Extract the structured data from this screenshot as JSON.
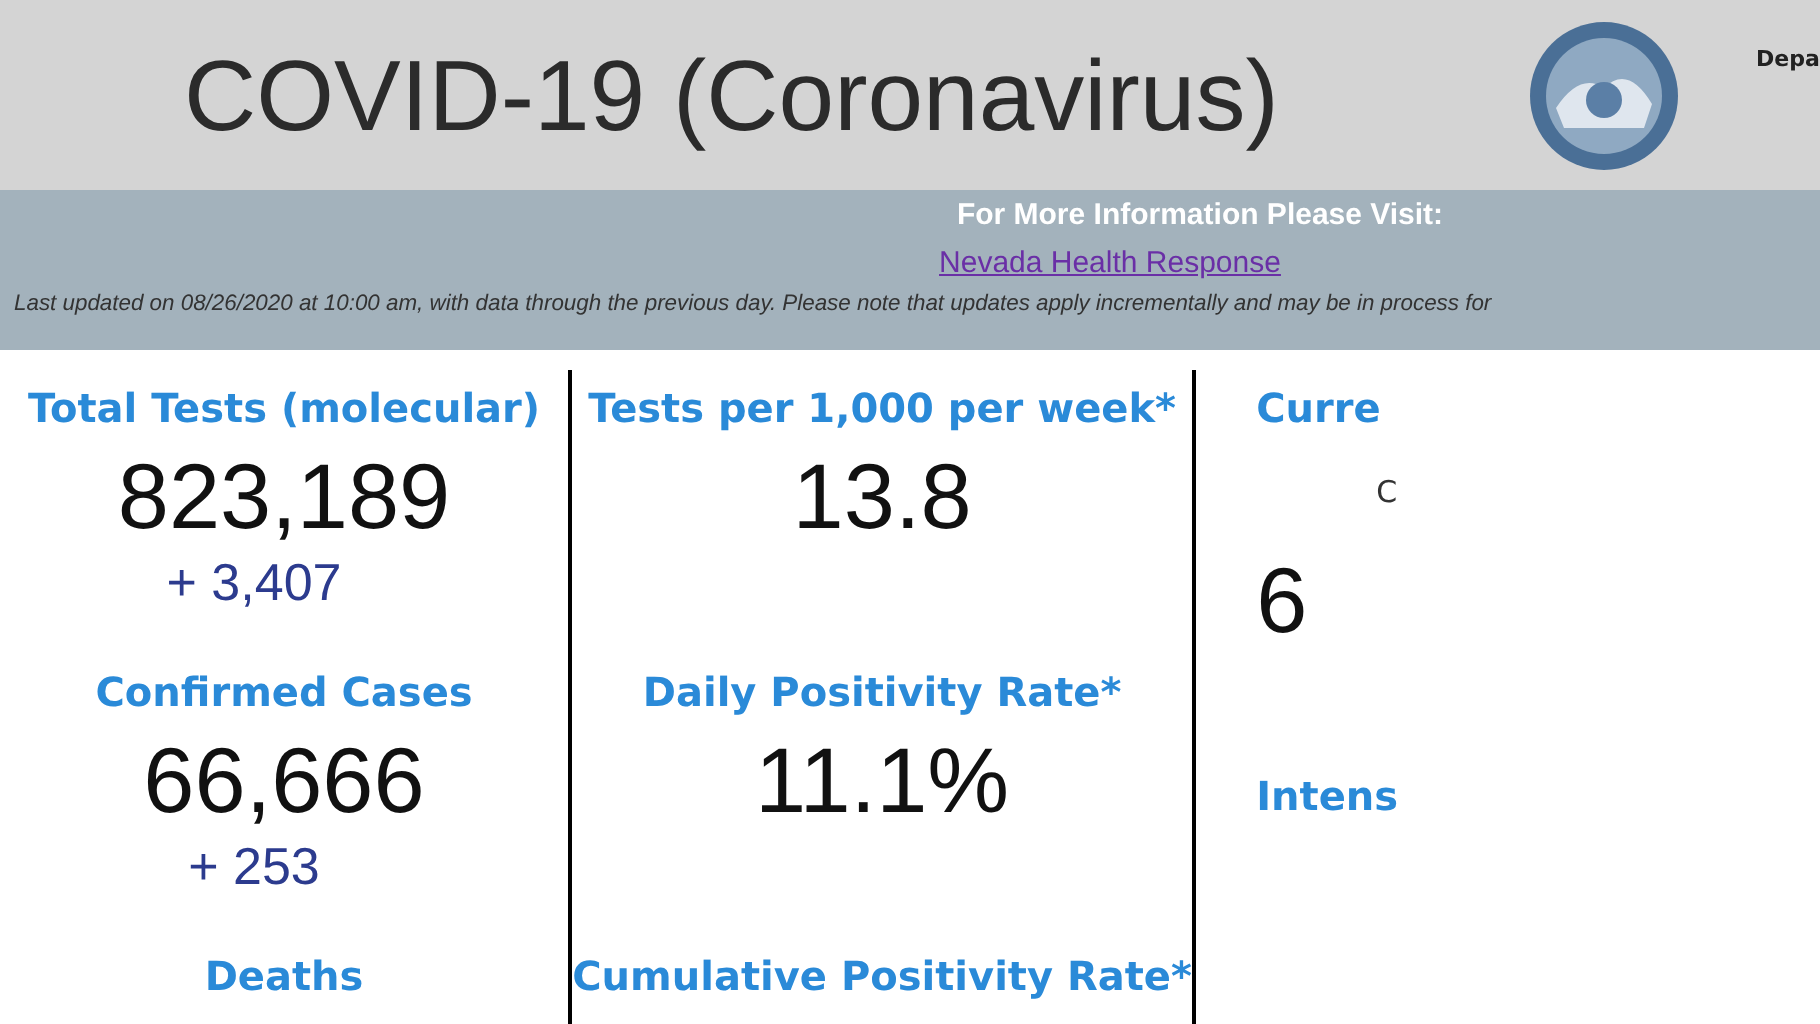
{
  "header": {
    "title": "COVID-19 (Coronavirus)",
    "department": "Depa"
  },
  "banner": {
    "heading": "For More Information Please Visit:",
    "link": "Nevada Health Response",
    "note": "Last updated on 08/26/2020 at 10:00 am, with data through the previous day.  Please note that updates apply incrementally and may be in process for"
  },
  "columns": [
    {
      "items": [
        {
          "kind": "heading",
          "text": "Total Tests (molecular)"
        },
        {
          "kind": "value",
          "text": "823,189"
        },
        {
          "kind": "change",
          "text": "+ 3,407"
        },
        {
          "kind": "heading",
          "text": "Confirmed Cases"
        },
        {
          "kind": "value",
          "text": "66,666"
        },
        {
          "kind": "change",
          "text": "+ 253"
        },
        {
          "kind": "heading",
          "text": "Deaths"
        }
      ]
    },
    {
      "items": [
        {
          "kind": "heading",
          "text": "Tests per 1,000 per week*"
        },
        {
          "kind": "value",
          "text": "13.8"
        },
        {
          "kind": "gap"
        },
        {
          "kind": "heading",
          "text": "Daily Positivity Rate*"
        },
        {
          "kind": "value",
          "text": "11.1%"
        },
        {
          "kind": "gap"
        },
        {
          "kind": "heading",
          "text": "Cumulative Positivity Rate*"
        }
      ]
    },
    {
      "items": [
        {
          "kind": "heading",
          "text": "Curre"
        },
        {
          "kind": "label",
          "text": "C"
        },
        {
          "kind": "value",
          "text": "6"
        },
        {
          "kind": "gap"
        },
        {
          "kind": "heading",
          "text": "Intens"
        }
      ]
    }
  ]
}
